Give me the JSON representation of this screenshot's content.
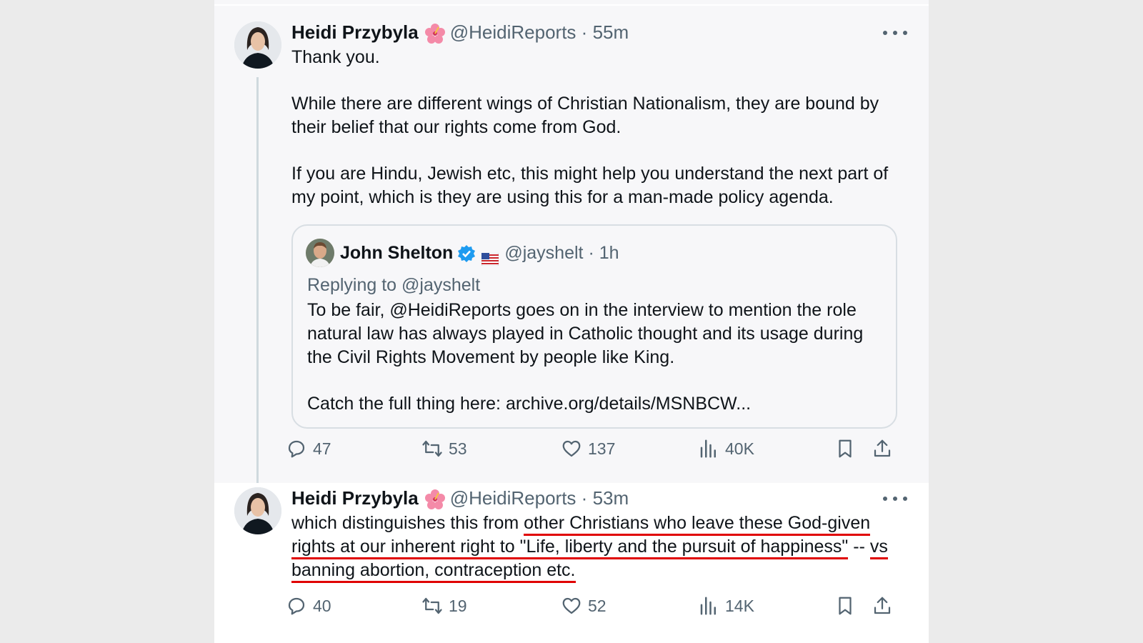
{
  "tweets": [
    {
      "author_name": "Heidi Przybyla",
      "handle": "@HeidiReports",
      "separator": "·",
      "time": "55m",
      "paragraphs": [
        "Thank you.",
        "While there are different wings of Christian Nationalism, they are bound by their belief that our rights come from God.",
        "If you are Hindu, Jewish etc, this might help you understand the next part of my point, which is they are using this for a man-made policy agenda."
      ],
      "quote": {
        "author_name": "John Shelton",
        "handle": "@jayshelt",
        "separator": "·",
        "time": "1h",
        "replying_to": "Replying to @jayshelt",
        "paragraphs": [
          "To be fair, @HeidiReports goes on in the interview to mention the role natural law has always played in Catholic thought and its usage during the Civil Rights Movement by people like King.",
          "Catch the full thing here: archive.org/details/MSNBCW..."
        ]
      },
      "actions": {
        "replies": "47",
        "reposts": "53",
        "likes": "137",
        "views": "40K"
      }
    },
    {
      "author_name": "Heidi Przybyla",
      "handle": "@HeidiReports",
      "separator": "·",
      "time": "53m",
      "text_plain": "which distinguishes this from ",
      "text_highlighted": "other Christians who leave these God-given rights at our inherent right to \"Life, liberty and the pursuit of happiness\"",
      "text_tail": " -- ",
      "text_highlighted_2": "vs banning abortion, contraception etc.",
      "actions": {
        "replies": "40",
        "reposts": "19",
        "likes": "52",
        "views": "14K"
      }
    }
  ],
  "icons": {
    "reply": "reply-icon",
    "repost": "repost-icon",
    "like": "heart-icon",
    "views": "views-icon",
    "bookmark": "bookmark-icon",
    "share": "share-icon",
    "more": "more-icon",
    "verified": "verified-badge-icon",
    "flag": "us-flag-icon",
    "flower": "hibiscus-emoji-icon"
  },
  "colors": {
    "underline": "#e00000",
    "verified": "#1d9bf0",
    "secondary_text": "#536471"
  }
}
